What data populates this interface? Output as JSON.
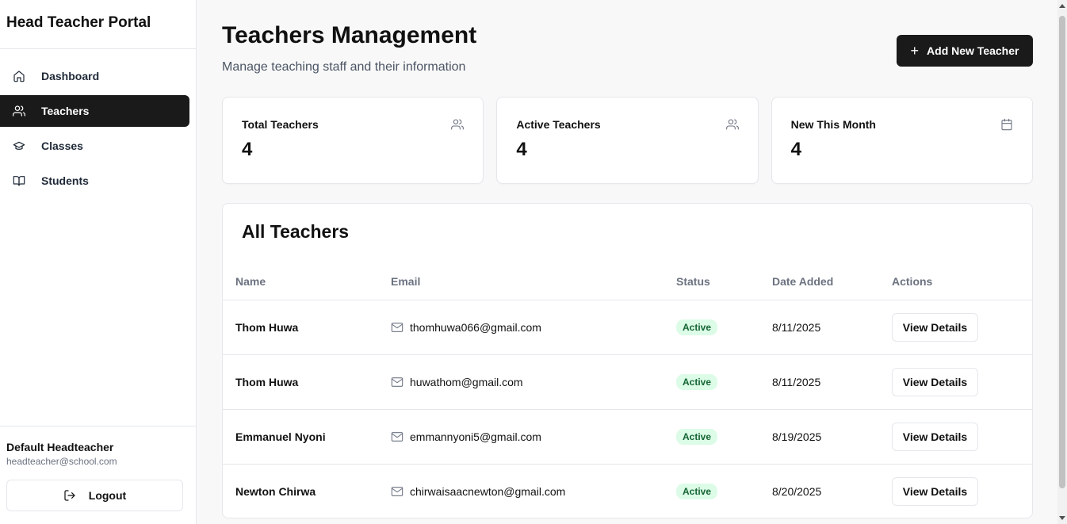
{
  "sidebar": {
    "brand": "Head Teacher Portal",
    "items": [
      {
        "label": "Dashboard",
        "icon": "home-icon",
        "active": false
      },
      {
        "label": "Teachers",
        "icon": "users-icon",
        "active": true
      },
      {
        "label": "Classes",
        "icon": "graduation-cap-icon",
        "active": false
      },
      {
        "label": "Students",
        "icon": "book-open-icon",
        "active": false
      }
    ],
    "user": {
      "name": "Default Headteacher",
      "email": "headteacher@school.com"
    },
    "logout_label": "Logout"
  },
  "header": {
    "title": "Teachers Management",
    "subtitle": "Manage teaching staff and their information",
    "add_button_label": "Add New Teacher"
  },
  "stats": [
    {
      "label": "Total Teachers",
      "value": "4",
      "icon": "users-icon"
    },
    {
      "label": "Active Teachers",
      "value": "4",
      "icon": "users-icon"
    },
    {
      "label": "New This Month",
      "value": "4",
      "icon": "calendar-icon"
    }
  ],
  "table": {
    "title": "All Teachers",
    "columns": [
      "Name",
      "Email",
      "Status",
      "Date Added",
      "Actions"
    ],
    "rows": [
      {
        "name": "Thom Huwa",
        "email": "thomhuwa066@gmail.com",
        "status": "Active",
        "date": "8/11/2025",
        "action": "View Details"
      },
      {
        "name": "Thom Huwa",
        "email": "huwathom@gmail.com",
        "status": "Active",
        "date": "8/11/2025",
        "action": "View Details"
      },
      {
        "name": "Emmanuel Nyoni",
        "email": "emmannyoni5@gmail.com",
        "status": "Active",
        "date": "8/19/2025",
        "action": "View Details"
      },
      {
        "name": "Newton Chirwa",
        "email": "chirwaisaacnewton@gmail.com",
        "status": "Active",
        "date": "8/20/2025",
        "action": "View Details"
      }
    ]
  },
  "colors": {
    "accent": "#1a1a1a",
    "badge_bg": "#dcfce7",
    "badge_text": "#166534"
  }
}
